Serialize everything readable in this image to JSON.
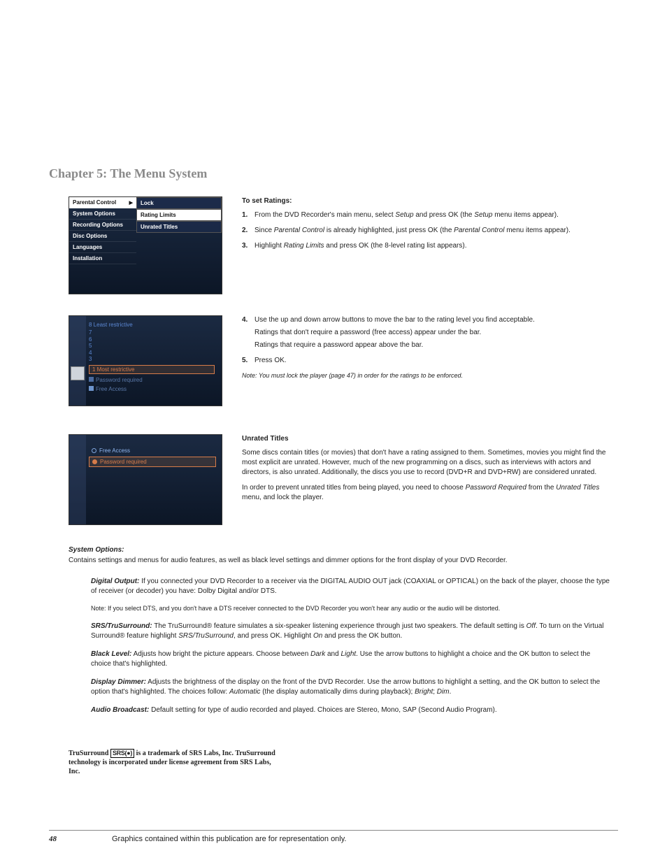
{
  "chapter_title": "Chapter 5: The Menu System",
  "menu": {
    "main": [
      "Parental Control",
      "System Options",
      "Recording Options",
      "Disc Options",
      "Languages",
      "Installation"
    ],
    "sub": [
      "Lock",
      "Rating Limits",
      "Unrated Titles"
    ]
  },
  "to_set_head": "To set Ratings:",
  "steps_a": [
    {
      "n": "1.",
      "pre": "From the DVD Recorder's main menu, select ",
      "em1": "Setup",
      "mid": " and press OK (the ",
      "em2": "Setup",
      "post": " menu items appear)."
    },
    {
      "n": "2.",
      "pre": "Since ",
      "em1": "Parental Control",
      "mid": " is already highlighted, just press OK (the ",
      "em2": "Parental Control",
      "post": " menu items appear)."
    },
    {
      "n": "3.",
      "pre": "Highlight ",
      "em1": "Rating Limits",
      "mid": " and press OK (the 8-level rating list appears).",
      "em2": "",
      "post": ""
    }
  ],
  "rating_screen": {
    "top": "8 Least restrictive",
    "nums": [
      "7",
      "6",
      "5",
      "4",
      "3"
    ],
    "bar": "1 Most restrictive",
    "legend1": "Password required",
    "legend2": "Free Access"
  },
  "steps_b": [
    {
      "n": "4.",
      "main": "Use the up and down arrow buttons to move the bar to the rating level you find acceptable.",
      "sub1": "Ratings that don't require a password (free access) appear under the bar.",
      "sub2": "Ratings that require a password appear above the bar."
    },
    {
      "n": "5.",
      "main": "Press OK."
    }
  ],
  "note_b": "Note: You must lock the player (page 47) in order for the ratings to be enforced.",
  "unrated_screen": {
    "opt1": "Free Access",
    "opt2": "Password required"
  },
  "unrated_head": "Unrated Titles",
  "unrated_p1": "Some discs contain titles (or movies) that don't have a rating assigned to them. Sometimes, movies you might find the most explicit are unrated. However, much of the new programming on a discs, such as interviews with actors and directors, is also unrated. Additionally, the discs you use to record (DVD+R and DVD+RW) are considered unrated.",
  "unrated_p2_a": "In order to prevent unrated titles from being played, you need to choose ",
  "unrated_p2_em1": "Password Required",
  "unrated_p2_b": " from the ",
  "unrated_p2_em2": "Unrated Titles",
  "unrated_p2_c": " menu, and lock the player.",
  "sys_head": "System Options:",
  "sys_intro": "Contains settings and menus for audio features, as well as black level settings and dimmer options for the front display of your DVD Recorder.",
  "opt_digital": {
    "lead": "Digital Output:",
    "body": "  If you connected your DVD Recorder to a receiver via the DIGITAL AUDIO OUT jack (COAXIAL or OPTICAL) on the back of the player, choose the type of receiver (or decoder) you have: Dolby Digital and/or DTS."
  },
  "opt_digital_note": "Note: If you select DTS, and you don't have a DTS receiver connected to the DVD Recorder you won't hear any audio or the audio will be distorted.",
  "opt_srs": {
    "lead": "SRS/TruSurround:",
    "a": "  The TruSurround® feature simulates a six-speaker listening experience through just two speakers. The default setting is ",
    "em1": "Off",
    "b": ". To turn on the Virtual Surround® feature highlight ",
    "em2": "SRS/TruSurround",
    "c": ", and press OK. Highlight ",
    "em3": "On",
    "d": " and press the OK button."
  },
  "opt_black": {
    "lead": "Black Level:",
    "a": "  Adjusts how bright the picture appears. Choose between ",
    "em1": "Dark",
    "b": " and ",
    "em2": "Light",
    "c": ". Use the arrow buttons to highlight a choice and the OK button to select the choice that's highlighted."
  },
  "opt_dimmer": {
    "lead": "Display Dimmer:",
    "a": " Adjusts the brightness of the display on the front of the DVD Recorder. Use the arrow buttons to highlight a setting, and the OK button to select the option that's highlighted. The choices follow: ",
    "em1": "Automatic",
    "b": " (the display automatically dims during playback); ",
    "em2": "Bright",
    "c": "; ",
    "em3": "Dim",
    "d": "."
  },
  "opt_audio": {
    "lead": "Audio Broadcast:",
    "body": " Default setting for type of audio recorded and played. Choices are Stereo, Mono, SAP (Second Audio Program)."
  },
  "trademark_a": "TruSurround ",
  "trademark_logo": "SRS(●)",
  "trademark_b": " is a trademark of SRS Labs, Inc. TruSurround technology is incorporated under license agreement from SRS Labs, Inc.",
  "footer": {
    "page": "48",
    "text": "Graphics contained within this publication are for representation only."
  }
}
